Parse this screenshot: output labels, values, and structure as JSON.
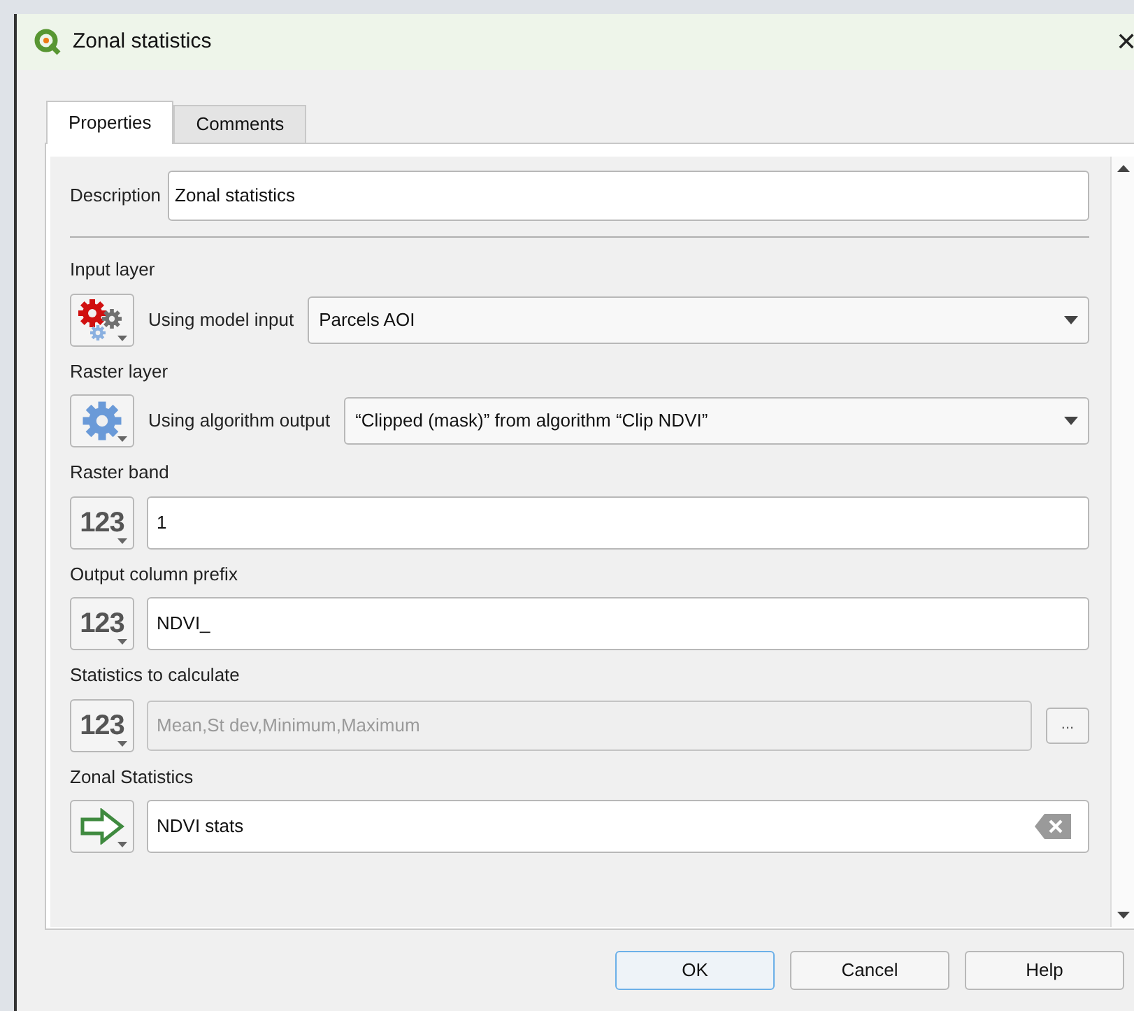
{
  "window": {
    "title": "Zonal statistics",
    "close": "✕"
  },
  "tabs": [
    {
      "label": "Properties",
      "selected": true
    },
    {
      "label": "Comments",
      "selected": false
    }
  ],
  "description": {
    "label": "Description",
    "value": "Zonal statistics"
  },
  "parameters": [
    {
      "label": "Input layer",
      "kind": "combo",
      "source": {
        "kind": "model_input"
      },
      "mode": "Using model input",
      "value": "Parcels AOI"
    },
    {
      "label": "Raster layer",
      "kind": "combo",
      "source": {
        "kind": "algorithm_output"
      },
      "mode": "Using algorithm output",
      "value": "“Clipped (mask)” from algorithm “Clip NDVI”"
    },
    {
      "label": "Raster band",
      "kind": "text",
      "source": {
        "kind": "value",
        "text": "123"
      },
      "value": "1"
    },
    {
      "label": "Output column prefix",
      "kind": "text",
      "source": {
        "kind": "value",
        "text": "123"
      },
      "value": "NDVI_"
    },
    {
      "label": "Statistics to calculate",
      "kind": "multi",
      "source": {
        "kind": "value",
        "text": "123"
      },
      "value": "Mean,St dev,Minimum,Maximum",
      "browse": "..."
    },
    {
      "label": "Zonal Statistics",
      "kind": "destination",
      "source": {
        "kind": "output"
      },
      "value": "NDVI stats"
    }
  ],
  "buttons": [
    {
      "label": "OK",
      "default": true
    },
    {
      "label": "Cancel",
      "default": false
    },
    {
      "label": "Help",
      "default": false
    }
  ]
}
